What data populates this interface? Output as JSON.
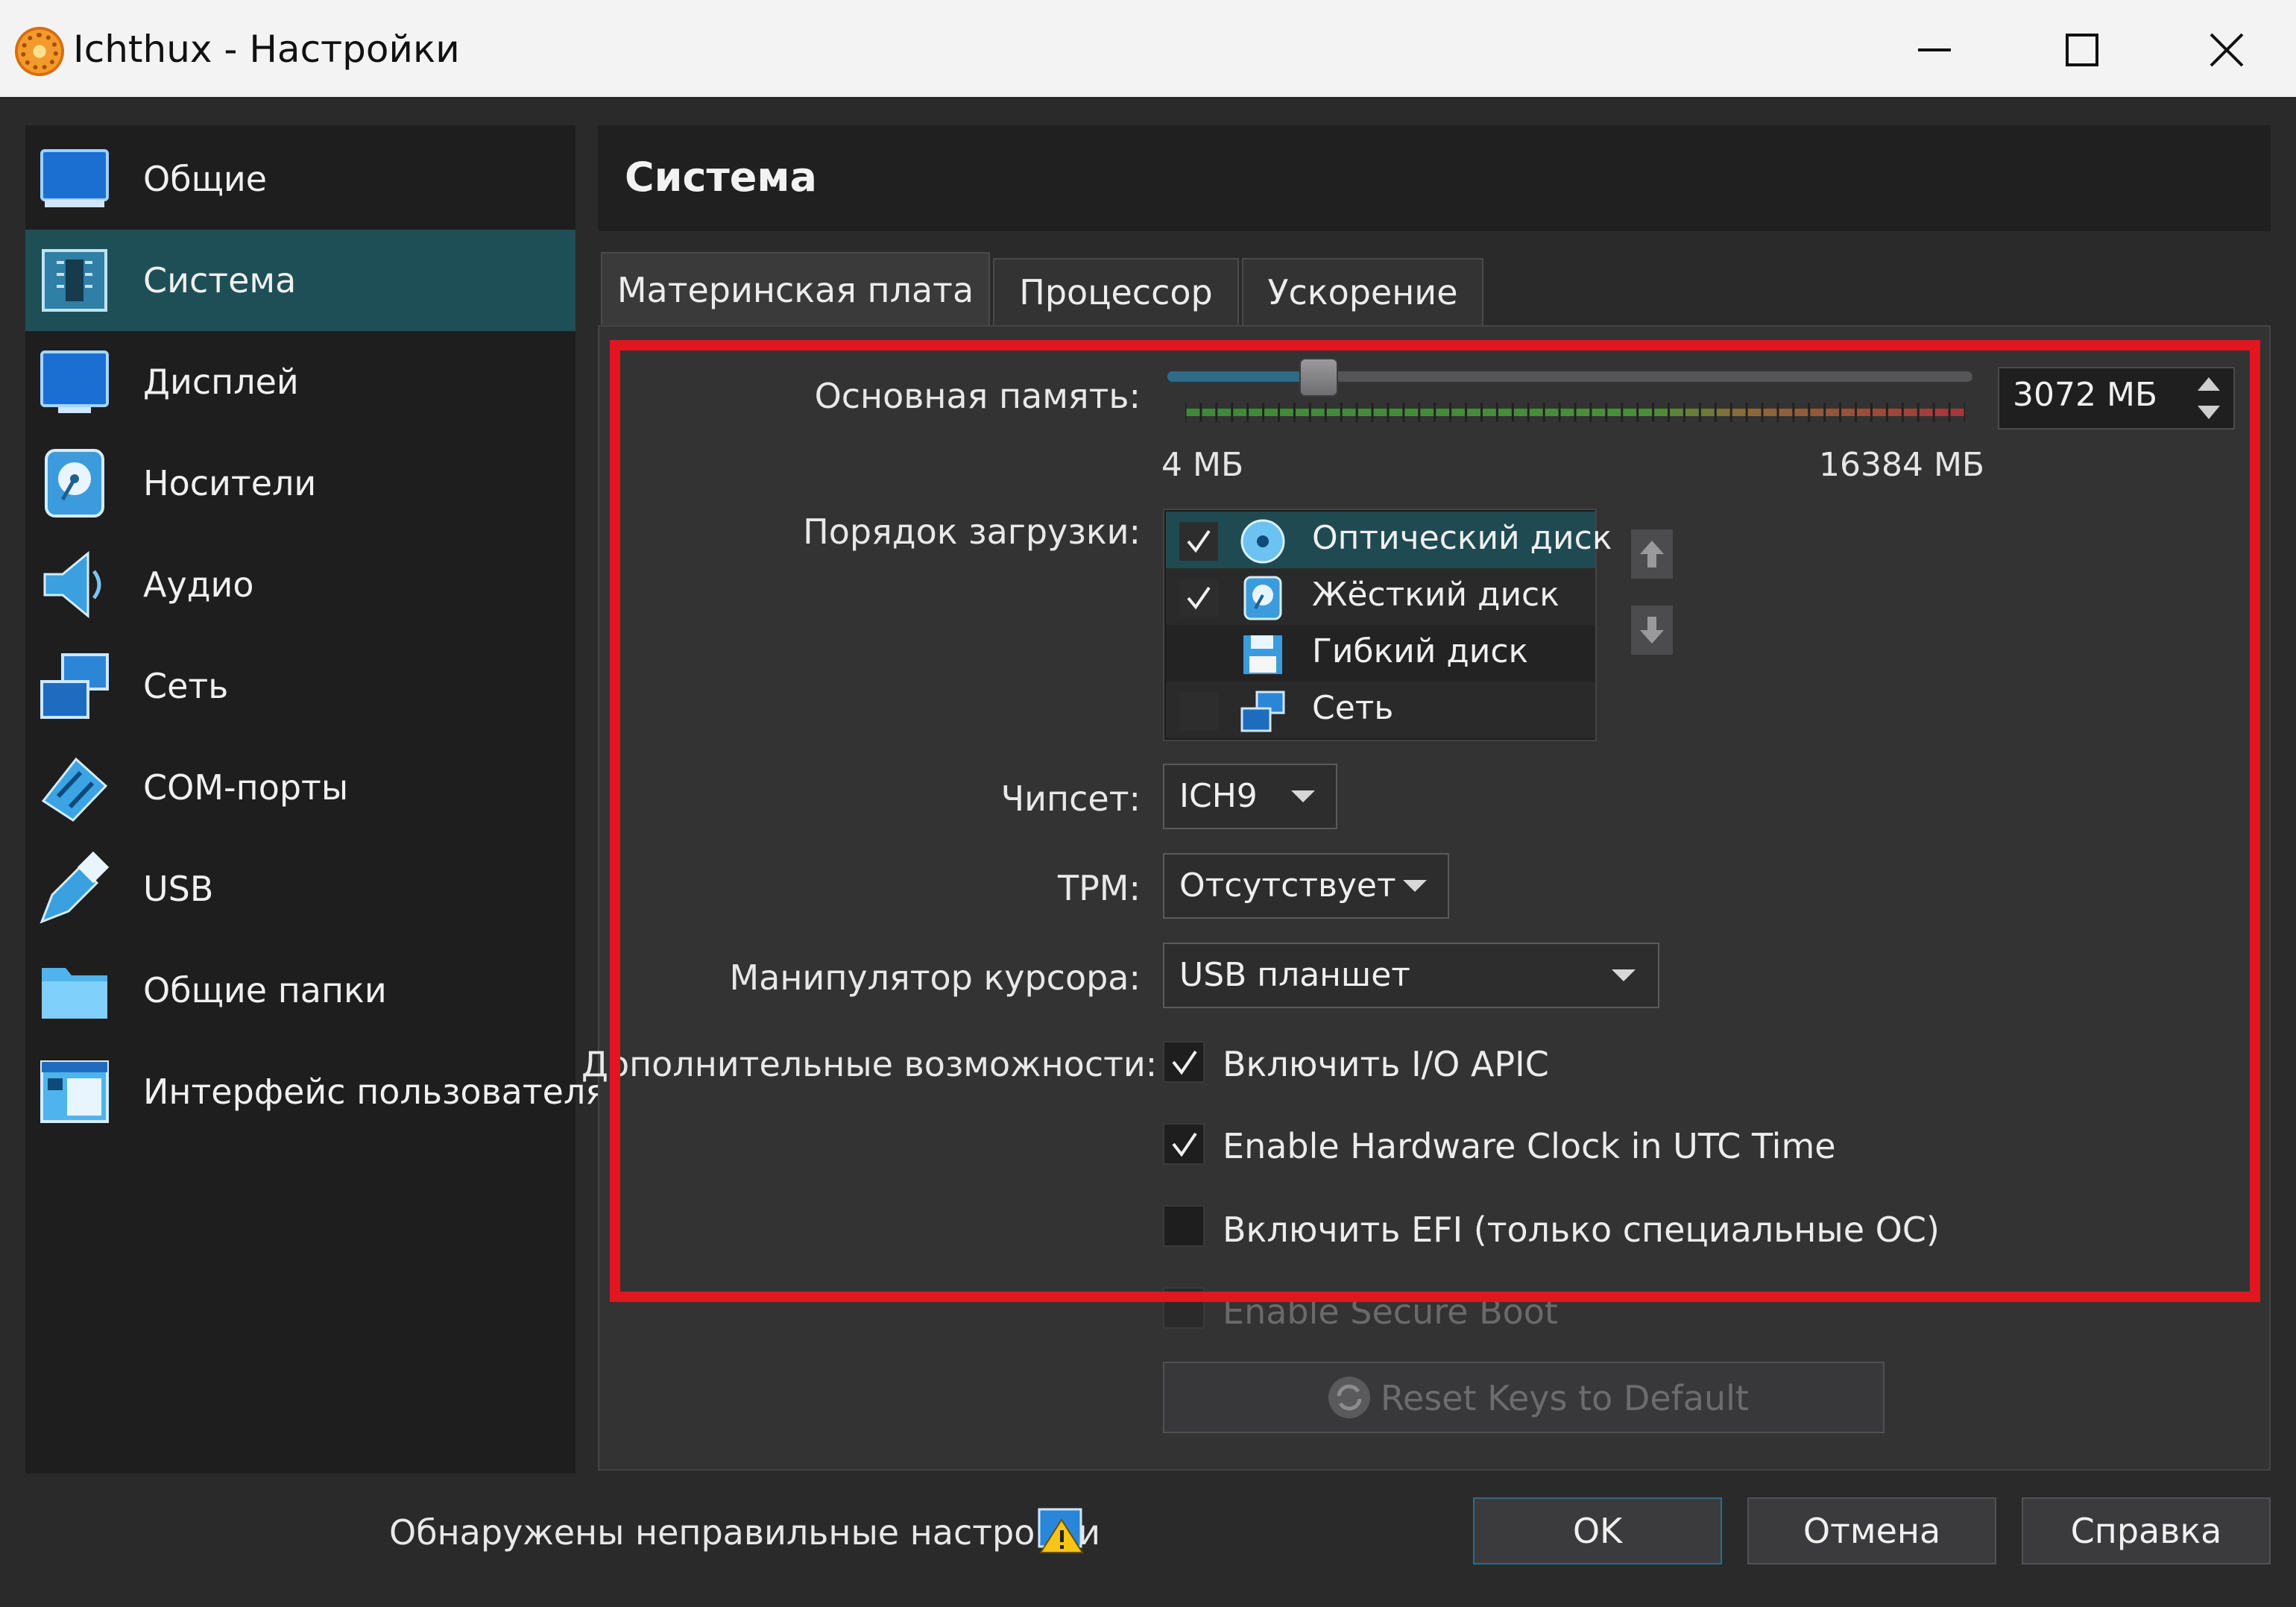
{
  "window": {
    "title": "Ichthux - Настройки",
    "controls": {
      "minimize": "minimize-icon",
      "maximize": "maximize-icon",
      "close": "close-icon"
    }
  },
  "sidebar": {
    "selected": "Система",
    "items": [
      {
        "label": "Общие",
        "icon": "monitor-icon"
      },
      {
        "label": "Система",
        "icon": "chip-icon"
      },
      {
        "label": "Дисплей",
        "icon": "display-icon"
      },
      {
        "label": "Носители",
        "icon": "storage-disk-icon"
      },
      {
        "label": "Аудио",
        "icon": "speaker-icon"
      },
      {
        "label": "Сеть",
        "icon": "network-icon"
      },
      {
        "label": "COM-порты",
        "icon": "serial-port-icon"
      },
      {
        "label": "USB",
        "icon": "usb-icon"
      },
      {
        "label": "Общие папки",
        "icon": "folder-icon"
      },
      {
        "label": "Интерфейс пользователя",
        "icon": "ui-window-icon"
      }
    ]
  },
  "section": {
    "title": "Система"
  },
  "tabs": [
    {
      "label": "Материнская плата",
      "active": true
    },
    {
      "label": "Процессор",
      "active": false
    },
    {
      "label": "Ускорение",
      "active": false
    }
  ],
  "motherboard": {
    "memory": {
      "label": "Основная память:",
      "value": "3072 МБ",
      "slider_level": 0.1875,
      "min_label": "4 МБ",
      "max_label": "16384 МБ"
    },
    "boot_order": {
      "label": "Порядок загрузки:",
      "items": [
        {
          "label": "Оптический диск",
          "checked": true,
          "icon": "optical-disc-icon"
        },
        {
          "label": "Жёсткий диск",
          "checked": true,
          "icon": "hard-disk-icon"
        },
        {
          "label": "Гибкий диск",
          "checked": false,
          "icon": "floppy-disk-icon"
        },
        {
          "label": "Сеть",
          "checked": false,
          "icon": "network-icon"
        }
      ]
    },
    "chipset": {
      "label": "Чипсет:",
      "value": "ICH9"
    },
    "tpm": {
      "label": "TPM:",
      "value": "Отсутствует"
    },
    "pointer": {
      "label": "Манипулятор курсора:",
      "value": "USB планшет"
    },
    "features": {
      "label": "Дополнительные возможности:",
      "io_apic": {
        "label": "Включить I/O APIC",
        "checked": true
      },
      "utc": {
        "label": "Enable Hardware Clock in UTC Time",
        "checked": true
      },
      "efi": {
        "label": "Включить EFI (только специальные ОС)",
        "checked": false
      },
      "secure_boot": {
        "label": "Enable Secure Boot",
        "checked": false,
        "enabled": false
      },
      "reset_keys": {
        "label": "Reset Keys to Default",
        "enabled": false
      }
    }
  },
  "footer": {
    "warning": "Обнаружены неправильные настройки",
    "ok": "OK",
    "cancel": "Отмена",
    "help": "Справка"
  },
  "colors": {
    "highlight_box": "#e0171f",
    "selection": "#1e4f56",
    "background": "#333334"
  }
}
